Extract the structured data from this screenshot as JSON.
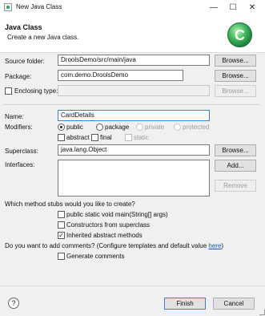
{
  "window": {
    "title": "New Java Class",
    "minimize_glyph": "—",
    "maximize_glyph": "☐",
    "close_glyph": "✕"
  },
  "header": {
    "title": "Java Class",
    "description": "Create a new Java class.",
    "logo_icon": "java-class-wizard-icon",
    "logo_letter": "C",
    "accent": "#2ea35b"
  },
  "source_folder": {
    "label": "Source folder:",
    "value": "DroolsDemo/src/main/java",
    "button": "Browse..."
  },
  "package": {
    "label": "Package:",
    "value": "com.demo.DroolsDemo",
    "button": "Browse..."
  },
  "enclosing": {
    "label": "Enclosing type:",
    "checked": false,
    "value": "",
    "button": "Browse..."
  },
  "name": {
    "label": "Name:",
    "value": "CardDetails"
  },
  "modifiers": {
    "label": "Modifiers:",
    "access": [
      {
        "label": "public",
        "checked": true,
        "enabled": true
      },
      {
        "label": "package",
        "checked": false,
        "enabled": true
      },
      {
        "label": "private",
        "checked": false,
        "enabled": false
      },
      {
        "label": "protected",
        "checked": false,
        "enabled": false
      }
    ],
    "flags": [
      {
        "label": "abstract",
        "checked": false,
        "enabled": true
      },
      {
        "label": "final",
        "checked": false,
        "enabled": true
      },
      {
        "label": "static",
        "checked": false,
        "enabled": false
      }
    ]
  },
  "superclass": {
    "label": "Superclass:",
    "value": "java.lang.Object",
    "button": "Browse..."
  },
  "interfaces": {
    "label": "Interfaces:",
    "add_button": "Add...",
    "remove_button": "Remove"
  },
  "stubs": {
    "question": "Which method stubs would you like to create?",
    "options": [
      {
        "label": "public static void main(String[] args)",
        "checked": false
      },
      {
        "label": "Constructors from superclass",
        "checked": false
      },
      {
        "label": "Inherited abstract methods",
        "checked": true
      }
    ]
  },
  "comments": {
    "question_prefix": "Do you want to add comments? (Configure templates and default value ",
    "link": "here",
    "question_suffix": ")",
    "option": "Generate comments",
    "checked": false
  },
  "footer": {
    "help_glyph": "?",
    "finish": "Finish",
    "cancel": "Cancel"
  }
}
